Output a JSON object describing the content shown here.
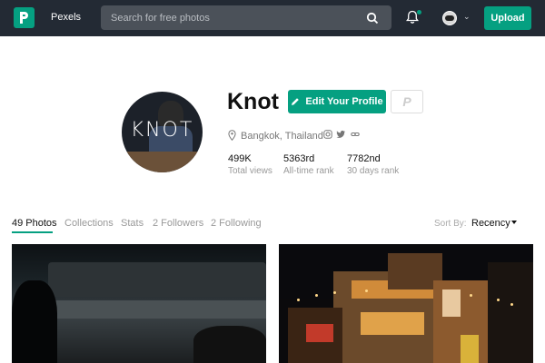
{
  "header": {
    "brand": "Pexels",
    "search_placeholder": "Search for free photos",
    "upload_label": "Upload"
  },
  "profile": {
    "avatar_text": "KNOT",
    "name": "Knot",
    "edit_label": "Edit Your Profile",
    "paypal_label": "P",
    "location": "Bangkok, Thailand",
    "stats": [
      {
        "value": "499K",
        "label": "Total views"
      },
      {
        "value": "5363rd",
        "label": "All-time rank"
      },
      {
        "value": "7782nd",
        "label": "30 days rank"
      }
    ]
  },
  "tabs": [
    {
      "label": "49 Photos",
      "active": true
    },
    {
      "label": "Collections",
      "active": false
    },
    {
      "label": "Stats",
      "active": false
    },
    {
      "label": "2 Followers",
      "active": false
    },
    {
      "label": "2 Following",
      "active": false
    }
  ],
  "sort": {
    "label": "Sort By:",
    "value": "Recency"
  },
  "colors": {
    "accent": "#05a081",
    "topbar": "#232a34"
  },
  "icons": [
    "pexels-logo-icon",
    "search-icon",
    "bell-icon",
    "chevron-down-icon",
    "pencil-icon",
    "paypal-icon",
    "location-pin-icon",
    "instagram-icon",
    "twitter-icon",
    "link-icon",
    "caret-down-icon"
  ]
}
